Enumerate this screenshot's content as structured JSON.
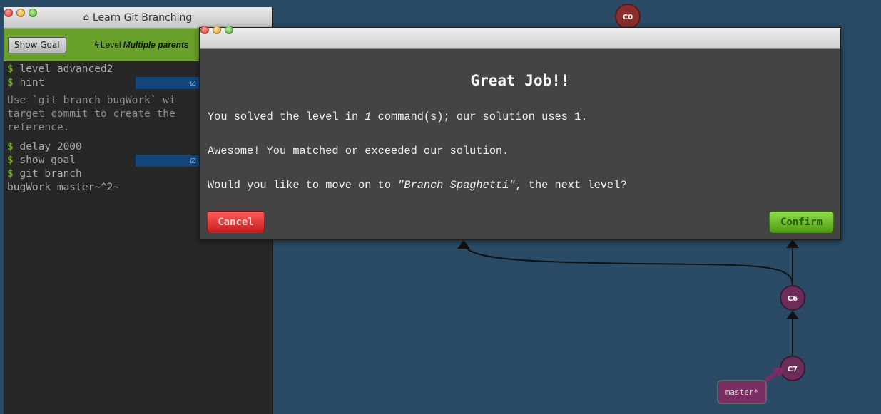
{
  "terminal": {
    "title": "Learn Git Branching",
    "show_goal_label": "Show Goal",
    "level_prefix": "Level",
    "level_name": "Multiple parents",
    "lines": [
      {
        "prompt": "$",
        "text": " level advanced2"
      },
      {
        "prompt": "$",
        "text": " hint"
      }
    ],
    "hint_text": "Use `git branch bugWork` wi\ntarget commit to create the\nreference.",
    "lines2": [
      {
        "prompt": "$",
        "text": " delay 2000"
      },
      {
        "prompt": "$",
        "text": " show goal"
      },
      {
        "prompt": "$",
        "text": " git branch"
      }
    ],
    "wrapped_line": "bugWork master~^2~"
  },
  "graph": {
    "commits": [
      "C0",
      "C6",
      "C7"
    ],
    "branch": "master*",
    "colors": {
      "background": "#2a4a66",
      "c0": "#8a2d2d",
      "c67": "#6d2d5a",
      "branch_box": "#7a2d62"
    }
  },
  "modal": {
    "title": "Great Job!!",
    "line1_a": "You solved the level in ",
    "line1_count": "1",
    "line1_b": " command(s); our solution uses 1.",
    "line2": "Awesome! You matched or exceeded our solution.",
    "line3_a": "Would you like to move on to ",
    "line3_level": "\"Branch Spaghetti\"",
    "line3_b": ", the next level?",
    "cancel_label": "Cancel",
    "confirm_label": "Confirm"
  }
}
